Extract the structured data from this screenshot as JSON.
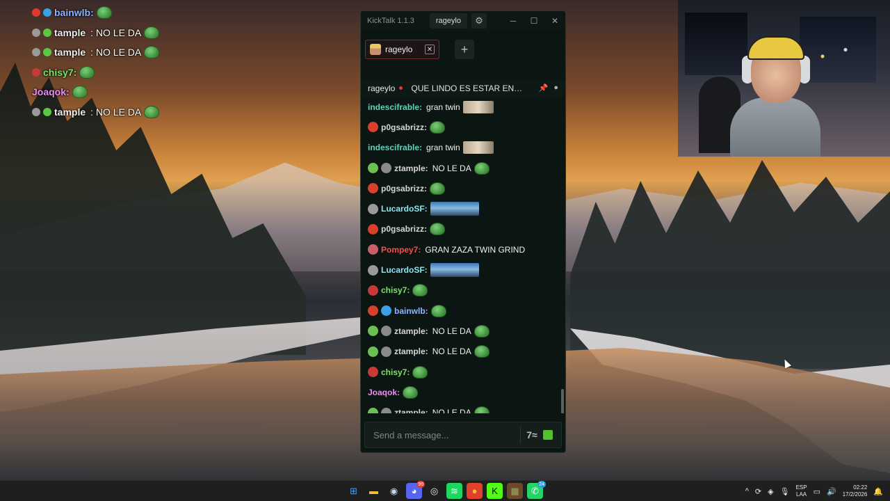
{
  "overlay_chat": [
    {
      "name": "bainwlb:",
      "name_color": "#8fb4ff",
      "message": "",
      "badges": [
        "#e03a2a",
        "#3aa0e8"
      ],
      "emote": true,
      "extra": true
    },
    {
      "name": "tample",
      "name_color": "#f0f0f0",
      "message": ": NO LE DA",
      "badges": [
        "#9a9a9a",
        "#5ac840"
      ],
      "emote": true
    },
    {
      "name": "tample",
      "name_color": "#f0f0f0",
      "message": ": NO LE DA",
      "badges": [
        "#9a9a9a",
        "#5ac840"
      ],
      "emote": true
    },
    {
      "name": "chisy7:",
      "name_color": "#7ee06a",
      "message": "",
      "badges": [
        "#c83a3a"
      ],
      "emote": true
    },
    {
      "name": "Joaqok:",
      "name_color": "#e88ef0",
      "message": "",
      "badges": [],
      "emote": true
    },
    {
      "name": "tample",
      "name_color": "#f0f0f0",
      "message": ": NO LE DA",
      "badges": [
        "#9a9a9a",
        "#5ac840"
      ],
      "emote": true
    }
  ],
  "kicktalk": {
    "app_title": "KickTalk 1.1.3",
    "username": "rageylo",
    "settings_icon": "gear-icon",
    "window_controls": {
      "minimize": "─",
      "maximize": "☐",
      "close": "✕"
    },
    "tab": {
      "label": "rageylo",
      "close": "✕"
    },
    "add_tab": "+",
    "channel": {
      "name": "rageylo",
      "stream_title": "QUE LINDO ES ESTAR EN ...",
      "icons": [
        "pin-icon",
        "user-icon"
      ]
    },
    "messages": [
      {
        "name": "indescifrable:",
        "color": "#5ed3b8",
        "text": "gran twin",
        "badges": [],
        "emote": "img"
      },
      {
        "name": "p0gsabrizz:",
        "color": "#d6d6d6",
        "text": "",
        "badges": [
          "#d8402c"
        ],
        "emote": "frog"
      },
      {
        "name": "indescifrable:",
        "color": "#5ed3b8",
        "text": "gran twin",
        "badges": [],
        "emote": "img"
      },
      {
        "name": "ztample:",
        "color": "#d6d6d6",
        "text": "NO LE DA",
        "badges": [
          "#6ac050",
          "#8a8a8a"
        ],
        "emote": "frog"
      },
      {
        "name": "p0gsabrizz:",
        "color": "#d6d6d6",
        "text": "",
        "badges": [
          "#d8402c"
        ],
        "emote": "frog"
      },
      {
        "name": "LucardoSF:",
        "color": "#8fe3f0",
        "text": "",
        "badges": [
          "#9a9a9a"
        ],
        "emote": "wide"
      },
      {
        "name": "p0gsabrizz:",
        "color": "#d6d6d6",
        "text": "",
        "badges": [
          "#d8402c"
        ],
        "emote": "frog"
      },
      {
        "name": "Pompey7:",
        "color": "#ff4a4a",
        "text": "GRAN ZAZA TWIN GRIND",
        "badges": [
          "#c8606a"
        ],
        "emote": ""
      },
      {
        "name": "LucardoSF:",
        "color": "#8fe3f0",
        "text": "",
        "badges": [
          "#9a9a9a"
        ],
        "emote": "wide"
      },
      {
        "name": "chisy7:",
        "color": "#7ee06a",
        "text": "",
        "badges": [
          "#c83a3a"
        ],
        "emote": "frog"
      },
      {
        "name": "bainwlb:",
        "color": "#8fb4ff",
        "text": "",
        "badges": [
          "#d8402c",
          "#3aa0e8"
        ],
        "emote": "frog"
      },
      {
        "name": "ztample:",
        "color": "#d6d6d6",
        "text": "NO LE DA",
        "badges": [
          "#6ac050",
          "#8a8a8a"
        ],
        "emote": "frog"
      },
      {
        "name": "ztample:",
        "color": "#d6d6d6",
        "text": "NO LE DA",
        "badges": [
          "#6ac050",
          "#8a8a8a"
        ],
        "emote": "frog"
      },
      {
        "name": "chisy7:",
        "color": "#7ee06a",
        "text": "",
        "badges": [
          "#c83a3a"
        ],
        "emote": "frog"
      },
      {
        "name": "Joaqok:",
        "color": "#e88ef0",
        "text": "",
        "badges": [],
        "emote": "frog"
      },
      {
        "name": "ztample:",
        "color": "#d6d6d6",
        "text": "NO LE DA",
        "badges": [
          "#6ac050",
          "#8a8a8a"
        ],
        "emote": "frog"
      }
    ],
    "input_placeholder": "Send a message...",
    "emote_button": "7≈"
  },
  "taskbar": {
    "apps": [
      {
        "name": "start-icon",
        "glyph": "⊞",
        "color": "#3aa0ff",
        "bg": "transparent",
        "badge": ""
      },
      {
        "name": "file-explorer-icon",
        "glyph": "▬",
        "color": "#f0c030",
        "bg": "transparent",
        "badge": ""
      },
      {
        "name": "steam-icon",
        "glyph": "◉",
        "color": "#c8d8e8",
        "bg": "transparent",
        "badge": ""
      },
      {
        "name": "discord-icon",
        "glyph": "◕",
        "color": "#ffffff",
        "bg": "#5865f2",
        "badge": "99"
      },
      {
        "name": "obs-icon",
        "glyph": "◎",
        "color": "#e8e8e8",
        "bg": "transparent",
        "badge": ""
      },
      {
        "name": "spotify-icon",
        "glyph": "≋",
        "color": "#ffffff",
        "bg": "#1ed760",
        "badge": ""
      },
      {
        "name": "chrome-icon",
        "glyph": "●",
        "color": "#f0c030",
        "bg": "#e0402c",
        "badge": ""
      },
      {
        "name": "kick-icon",
        "glyph": "K",
        "color": "#0b0b0b",
        "bg": "#53fc18",
        "badge": ""
      },
      {
        "name": "minecraft-icon",
        "glyph": "▦",
        "color": "#7ac048",
        "bg": "#6a4a2a",
        "badge": ""
      },
      {
        "name": "whatsapp-icon",
        "glyph": "✆",
        "color": "#ffffff",
        "bg": "#25d366",
        "badge": "24"
      }
    ],
    "tray": {
      "chevron": "^",
      "lang_top": "ESP",
      "lang_bottom": "LAA",
      "time": "02:22",
      "date": "17/2/2026"
    }
  }
}
